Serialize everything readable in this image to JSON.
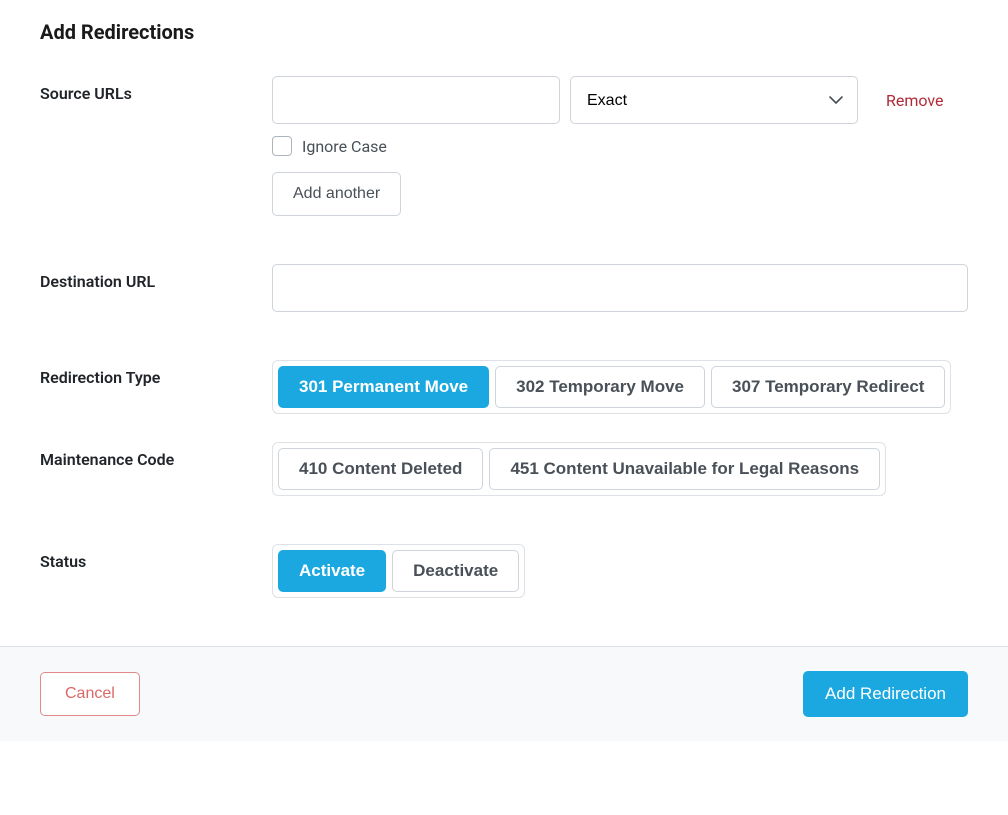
{
  "page_title": "Add Redirections",
  "labels": {
    "source_urls": "Source URLs",
    "destination_url": "Destination URL",
    "redirection_type": "Redirection Type",
    "maintenance_code": "Maintenance Code",
    "status": "Status"
  },
  "source": {
    "input_value": "",
    "match_type_selected": "Exact",
    "remove_label": "Remove",
    "ignore_case_label": "Ignore Case",
    "ignore_case_checked": false,
    "add_another_label": "Add another"
  },
  "destination": {
    "input_value": ""
  },
  "redirection_type": {
    "options": [
      {
        "label": "301 Permanent Move",
        "selected": true
      },
      {
        "label": "302 Temporary Move",
        "selected": false
      },
      {
        "label": "307 Temporary Redirect",
        "selected": false
      }
    ]
  },
  "maintenance_code": {
    "options": [
      {
        "label": "410 Content Deleted",
        "selected": false
      },
      {
        "label": "451 Content Unavailable for Legal Reasons",
        "selected": false
      }
    ]
  },
  "status": {
    "options": [
      {
        "label": "Activate",
        "selected": true
      },
      {
        "label": "Deactivate",
        "selected": false
      }
    ]
  },
  "footer": {
    "cancel_label": "Cancel",
    "submit_label": "Add Redirection"
  }
}
